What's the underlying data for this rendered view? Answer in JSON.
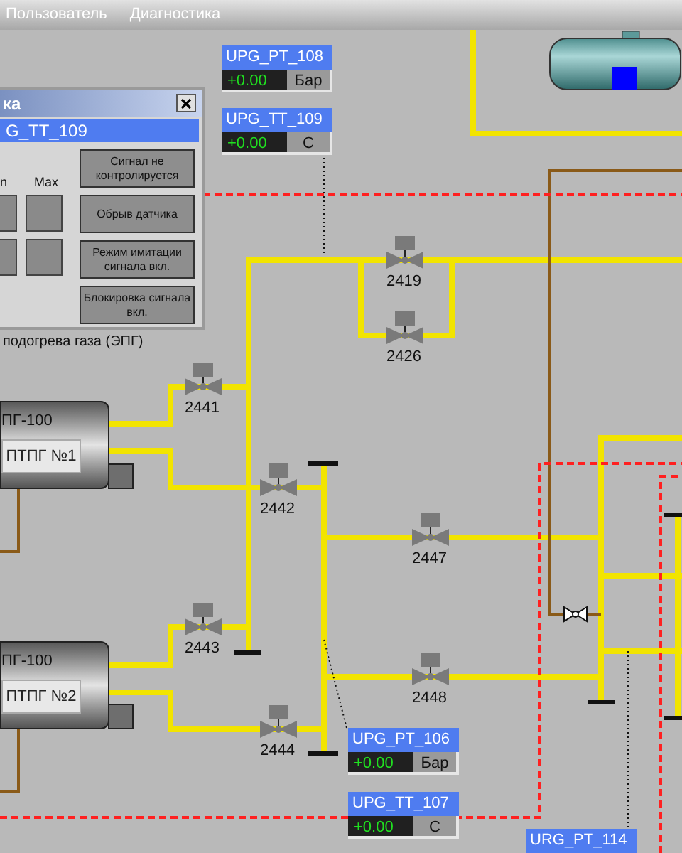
{
  "menu": [
    "Пользователь",
    "Диагностика"
  ],
  "dialog": {
    "title": "ка",
    "tag": "G_TT_109",
    "column_labels": [
      "n",
      "Max"
    ],
    "buttons": [
      "Сигнал не контролируется",
      "Обрыв датчика",
      "Режим имитации сигнала вкл.",
      "Блокировка сигнала вкл."
    ]
  },
  "caption": "подогрева газа (ЭПГ)",
  "tags": [
    {
      "name": "UPG_PT_108",
      "value": "+0.00",
      "unit": "Бар"
    },
    {
      "name": "UPG_TT_109",
      "value": "+0.00",
      "unit": "С"
    },
    {
      "name": "UPG_PT_106",
      "value": "+0.00",
      "unit": "Бар"
    },
    {
      "name": "UPG_TT_107",
      "value": "+0.00",
      "unit": "С"
    },
    {
      "name": "URG_PT_114"
    }
  ],
  "heaters": [
    {
      "model": "ПГ-100",
      "button": "ПТПГ №1"
    },
    {
      "model": "ПГ-100",
      "button": "ПТПГ №2"
    }
  ],
  "valves": [
    {
      "label": "2419"
    },
    {
      "label": "2426"
    },
    {
      "label": "2441"
    },
    {
      "label": "2442"
    },
    {
      "label": "2443"
    },
    {
      "label": "2444"
    },
    {
      "label": "2447"
    },
    {
      "label": "2448"
    }
  ]
}
